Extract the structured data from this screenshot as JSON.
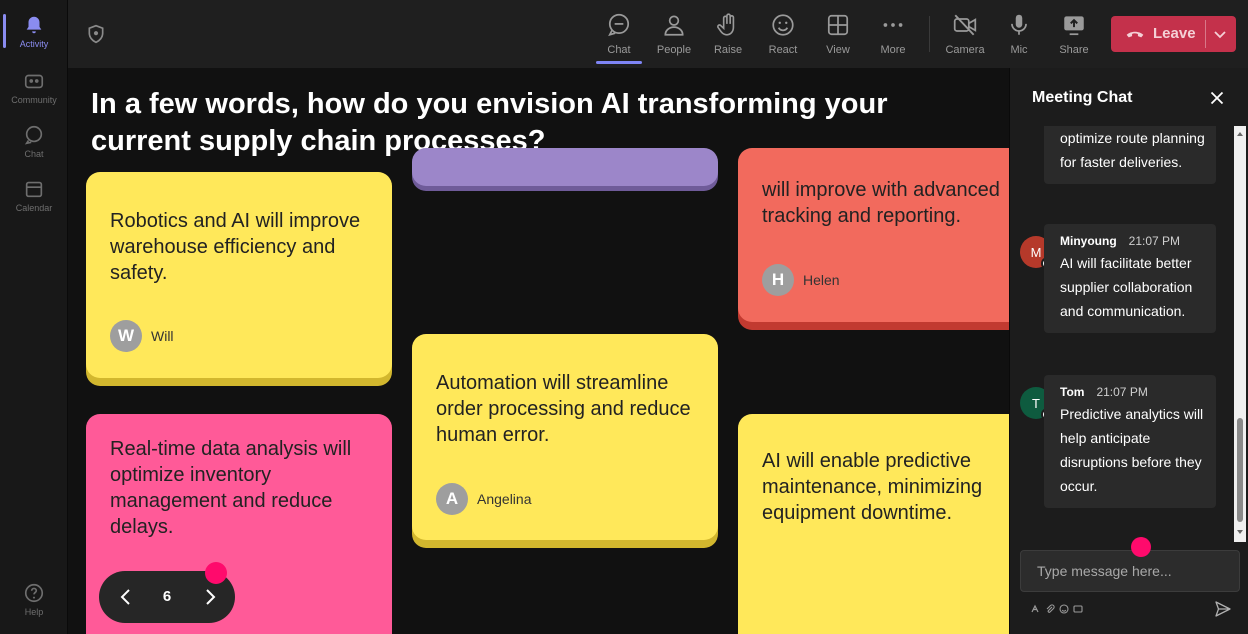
{
  "rail": {
    "items": [
      {
        "label": "Activity",
        "icon": "bell-icon"
      },
      {
        "label": "Community",
        "icon": "community-icon"
      },
      {
        "label": "Chat",
        "icon": "chat-icon"
      },
      {
        "label": "Calendar",
        "icon": "calendar-icon"
      },
      {
        "label": "Help",
        "icon": "help-icon"
      }
    ]
  },
  "toolbar": {
    "chat": "Chat",
    "people": "People",
    "raise": "Raise",
    "react": "React",
    "view": "View",
    "more": "More",
    "camera": "Camera",
    "mic": "Mic",
    "share": "Share",
    "leave": "Leave"
  },
  "stage": {
    "question": "In a few words, how do you envision AI transforming your current supply chain processes?",
    "notes": [
      {
        "text": "Robotics and AI will improve warehouse efficiency and safety.",
        "author": "Will",
        "initial": "W"
      },
      {
        "text": "will improve with advanced tracking and reporting.",
        "author": "Helen",
        "initial": "H"
      },
      {
        "text": "Automation will streamline order processing and reduce human error.",
        "author": "Angelina",
        "initial": "A"
      },
      {
        "text": "Real-time data analysis will optimize inventory management and reduce delays."
      },
      {
        "text": "AI will enable predictive maintenance, minimizing equipment downtime."
      }
    ],
    "page": "6"
  },
  "chat": {
    "title": "Meeting Chat",
    "messages": [
      {
        "text": "optimize route planning for faster deliveries."
      },
      {
        "author": "Minyoung",
        "initial": "M",
        "time": "21:07 PM",
        "text": "AI will facilitate better supplier collaboration and communication."
      },
      {
        "author": "Tom",
        "initial": "T",
        "time": "21:07 PM",
        "text": "Predictive analytics will help anticipate disruptions before they occur."
      }
    ],
    "placeholder": "Type message here..."
  },
  "colors": {
    "accent": "#7f85f5",
    "leave": "#c4314b",
    "note_yellow": "#ffe85a",
    "note_red": "#f26a5d",
    "note_pink": "#ff5a98",
    "note_purple": "#9c86c9",
    "marker": "#ff0a6c",
    "avatar_minyoung": "#b5392a",
    "avatar_tom": "#0e5b3f"
  }
}
